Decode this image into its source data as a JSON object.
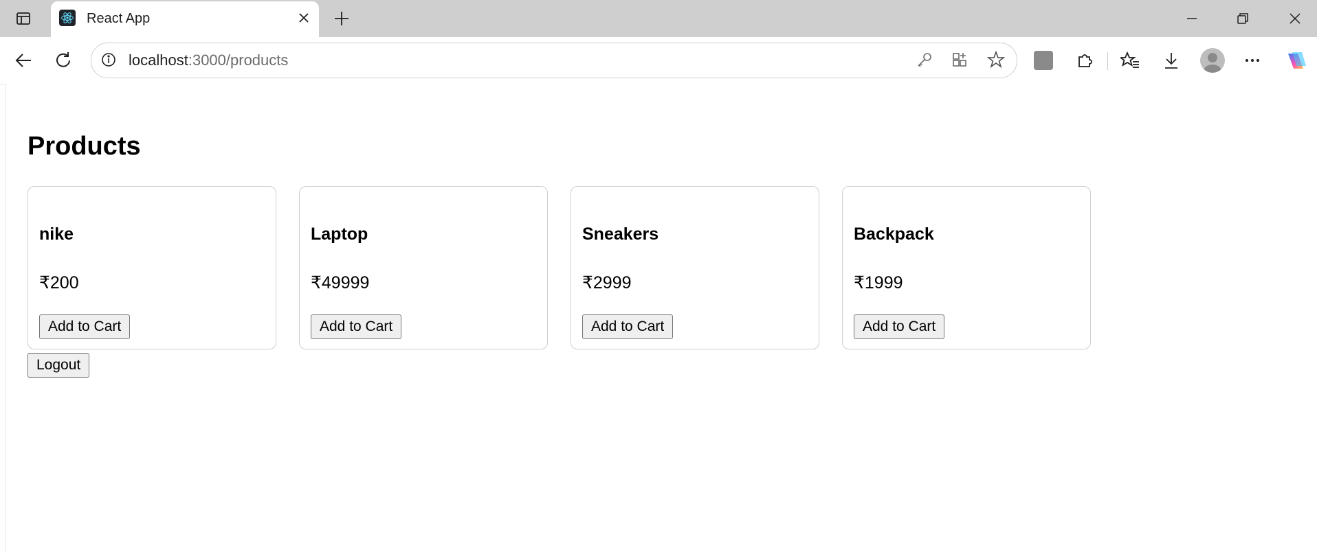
{
  "browser": {
    "tab_title": "React App",
    "url_host": "localhost",
    "url_rest": ":3000/products"
  },
  "page": {
    "title": "Products",
    "add_label": "Add to Cart",
    "logout_label": "Logout",
    "products": [
      {
        "name": "nike",
        "price": "₹200"
      },
      {
        "name": "Laptop",
        "price": "₹49999"
      },
      {
        "name": "Sneakers",
        "price": "₹2999"
      },
      {
        "name": "Backpack",
        "price": "₹1999"
      }
    ]
  },
  "colors": {
    "tabstrip": "#cfcfcf",
    "card_border": "#cfcfcf",
    "copilot_gradient": [
      "#2f80ff",
      "#ff4fb3",
      "#ffc14d"
    ]
  }
}
